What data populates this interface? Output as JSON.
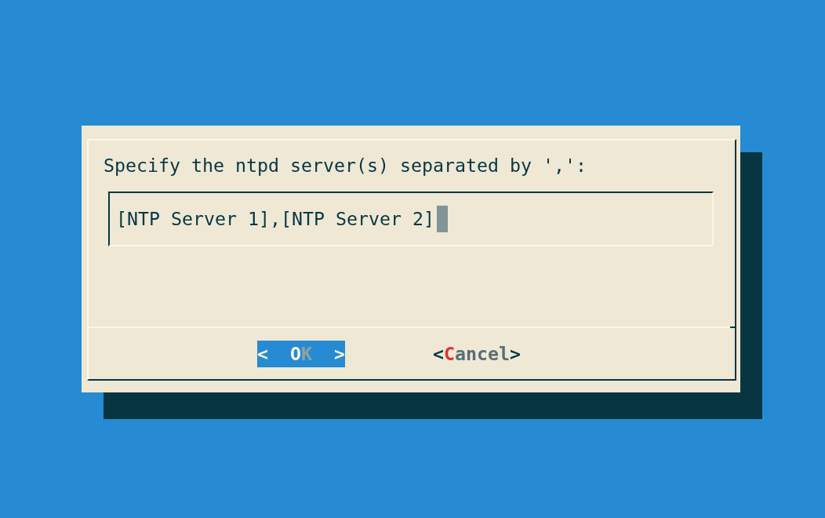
{
  "dialog": {
    "prompt": "Specify the ntpd server(s) separated by ',':",
    "input": {
      "value": "[NTP Server 1],[NTP Server 2]",
      "cursor": true
    },
    "buttons": [
      {
        "open": "<",
        "hotkey": "O",
        "rest": "K",
        "close": ">",
        "selected": true
      },
      {
        "open": "<",
        "hotkey": "C",
        "rest": "ancel",
        "close": ">",
        "selected": false
      }
    ]
  }
}
